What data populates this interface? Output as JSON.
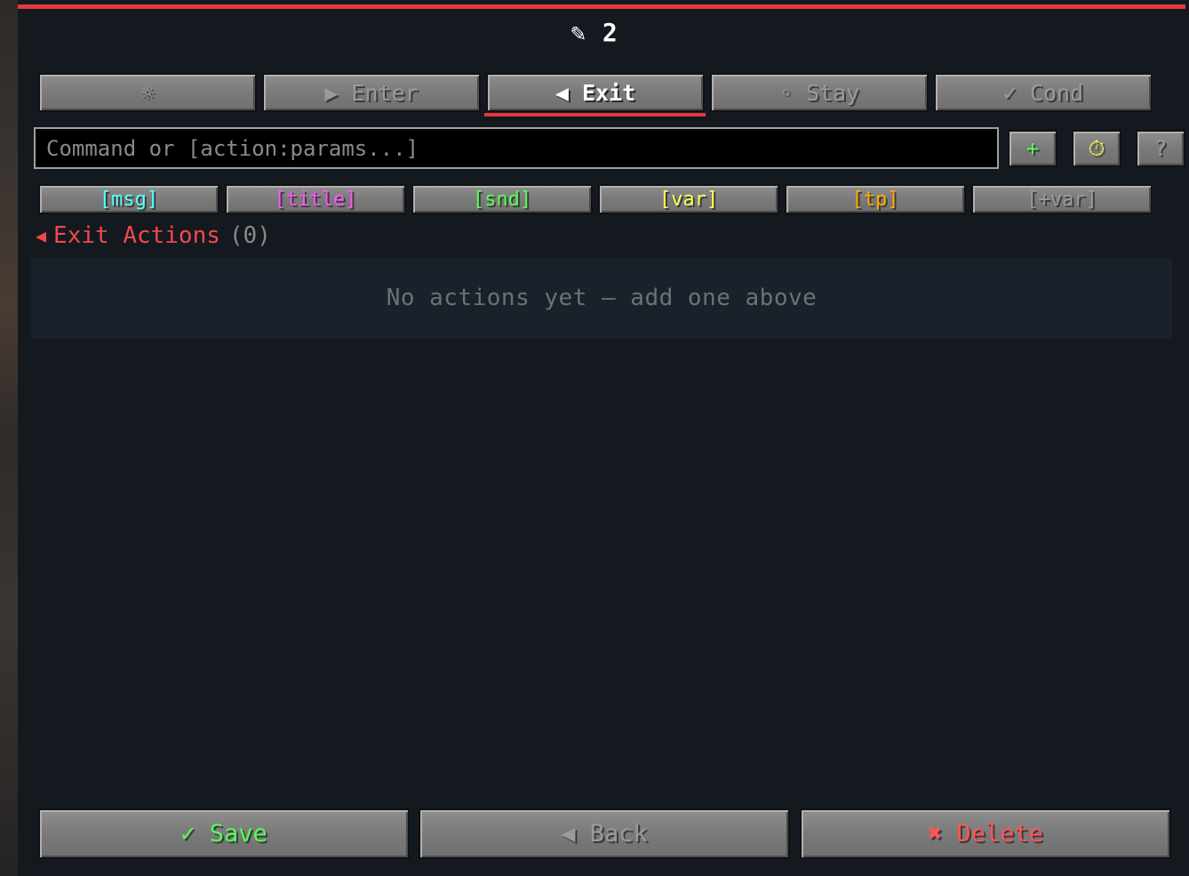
{
  "window": {
    "title_icon": "✎",
    "title": "2"
  },
  "colors": {
    "accent": "#e23b3b",
    "msg": "#55ffff",
    "title": "#ff55ff",
    "snd": "#55ff55",
    "var": "#ffff55",
    "tp": "#ffaa00",
    "plusvar": "#9a9a9a",
    "save": "#55ff55",
    "delete": "#ff5555"
  },
  "tabs": [
    {
      "label": "☼",
      "icon": "gear-icon",
      "active": false
    },
    {
      "label": "▶ Enter",
      "icon": "play-icon",
      "active": false
    },
    {
      "label": "◀ Exit",
      "icon": "exit-icon",
      "active": true
    },
    {
      "label": "◦ Stay",
      "icon": "stay-icon",
      "active": false
    },
    {
      "label": "✓ Cond",
      "icon": "check-icon",
      "active": false
    }
  ],
  "command": {
    "value": "",
    "placeholder": "Command or [action:params...]"
  },
  "tools": {
    "add": "+",
    "timer": "⏱",
    "help": "?"
  },
  "chips": [
    {
      "label": "[msg]"
    },
    {
      "label": "[title]"
    },
    {
      "label": "[snd]"
    },
    {
      "label": "[var]"
    },
    {
      "label": "[tp]"
    },
    {
      "label": "[+var]"
    }
  ],
  "section": {
    "icon": "◀",
    "label": "Exit Actions",
    "count": "(0)"
  },
  "empty_state": "No actions yet — add one above",
  "bottom_buttons": {
    "save": "✓ Save",
    "back": "◀ Back",
    "delete": "✖ Delete"
  }
}
